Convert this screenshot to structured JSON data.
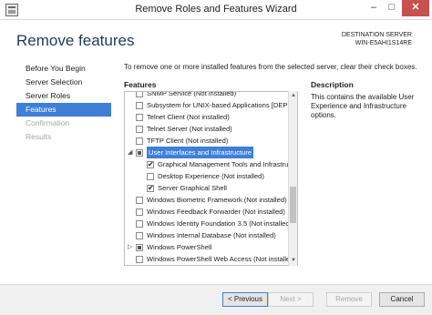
{
  "window": {
    "title": "Remove Roles and Features Wizard",
    "min_glyph": "–",
    "max_glyph": "□",
    "close_glyph": "✕"
  },
  "header": {
    "title": "Remove features",
    "destination_label": "DESTINATION SERVER",
    "destination_server": "WIN-E5AHI1S14RE"
  },
  "nav": {
    "items": [
      {
        "label": "Before You Begin",
        "state": "normal"
      },
      {
        "label": "Server Selection",
        "state": "normal"
      },
      {
        "label": "Server Roles",
        "state": "normal"
      },
      {
        "label": "Features",
        "state": "active"
      },
      {
        "label": "Confirmation",
        "state": "disabled"
      },
      {
        "label": "Results",
        "state": "disabled"
      }
    ]
  },
  "main": {
    "intro": "To remove one or more installed features from the selected server, clear their check boxes.",
    "features_label": "Features",
    "description_label": "Description",
    "description_text": "This contains the available User Experience and Infrastructure options."
  },
  "tree": {
    "rows": [
      {
        "label": "SNMP Service (Not installed)",
        "indent": 1,
        "check": "none",
        "expander": ""
      },
      {
        "label": "Subsystem for UNIX-based Applications [DEPRE",
        "indent": 1,
        "check": "none",
        "expander": ""
      },
      {
        "label": "Telnet Client (Not installed)",
        "indent": 1,
        "check": "none",
        "expander": ""
      },
      {
        "label": "Telnet Server (Not installed)",
        "indent": 1,
        "check": "none",
        "expander": ""
      },
      {
        "label": "TFTP Client (Not installed)",
        "indent": 1,
        "check": "none",
        "expander": ""
      },
      {
        "label": "User Interfaces and Infrastructure",
        "indent": 1,
        "check": "partial",
        "expander": "◢",
        "selected": true
      },
      {
        "label": "Graphical Management Tools and Infrastruct",
        "indent": 2,
        "check": "checked",
        "expander": ""
      },
      {
        "label": "Desktop Experience (Not installed)",
        "indent": 2,
        "check": "none",
        "expander": ""
      },
      {
        "label": "Server Graphical Shell",
        "indent": 2,
        "check": "checked",
        "expander": ""
      },
      {
        "label": "Windows Biometric Framework (Not installed)",
        "indent": 1,
        "check": "none",
        "expander": ""
      },
      {
        "label": "Windows Feedback Forwarder (Not installed)",
        "indent": 1,
        "check": "none",
        "expander": ""
      },
      {
        "label": "Windows Identity Foundation 3.5 (Not installed)",
        "indent": 1,
        "check": "none",
        "expander": ""
      },
      {
        "label": "Windows Internal Database (Not installed)",
        "indent": 1,
        "check": "none",
        "expander": ""
      },
      {
        "label": "Windows PowerShell",
        "indent": 1,
        "check": "partial",
        "expander": "▷"
      },
      {
        "label": "Windows PowerShell Web Access (Not installed)",
        "indent": 1,
        "check": "none",
        "expander": ""
      }
    ]
  },
  "scrollbar": {
    "up_glyph": "▲",
    "down_glyph": "▼"
  },
  "footer": {
    "previous_label": "< Previous",
    "next_label": "Next >",
    "remove_label": "Remove",
    "cancel_label": "Cancel"
  },
  "colors": {
    "accent": "#3f7fd8",
    "title_blue": "#1e395b",
    "close_red": "#c75050"
  }
}
